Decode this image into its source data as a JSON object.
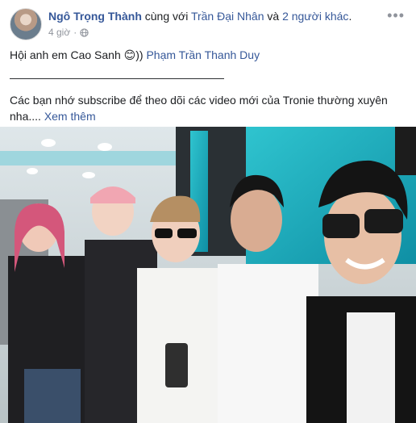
{
  "post": {
    "author": "Ngô Trọng Thành",
    "with_text": " cùng với ",
    "tag1": "Trần Đại Nhân",
    "and_text": " và ",
    "tag2": "2 người khác",
    "tag_end": ".",
    "time": "4 giờ",
    "dot": "·",
    "privacy_icon": "globe-icon",
    "more_icon": "ellipsis-icon",
    "line1": "Hội anh em Cao Sanh ",
    "emoji": "😊",
    "line1_after": ")) ",
    "mention": "Phạm Trần Thanh Duy",
    "divider": "———————————————————",
    "line3": "Các bạn nhớ subscribe để theo dõi các video mới của Tronie thường xuyên nha.... ",
    "see_more": "Xem thêm"
  }
}
